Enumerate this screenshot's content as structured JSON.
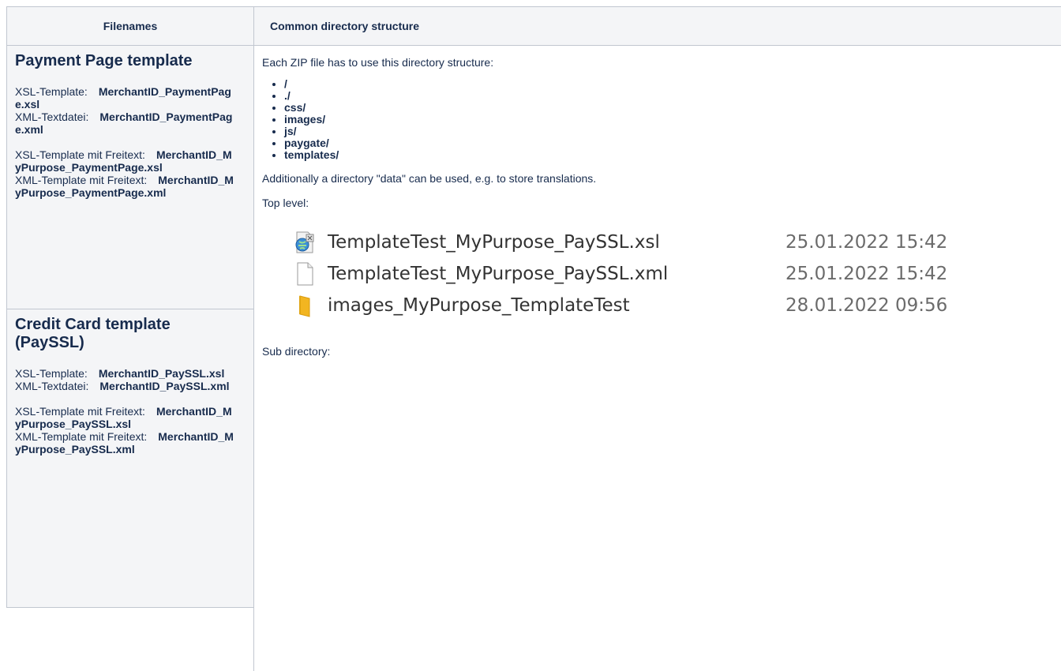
{
  "header": {
    "col1": "Filenames",
    "col2": "Common directory structure"
  },
  "payment": {
    "title": "Payment Page template",
    "rows": [
      {
        "k": "XSL-Template:",
        "v": "MerchantID_PaymentPage.xsl"
      },
      {
        "k": "XML-Textdatei:",
        "v": "MerchantID_PaymentPage.xml"
      },
      {
        "k": "XSL-Template mit Freitext:",
        "v": "MerchantID_MyPurpose_PaymentPage.xsl"
      },
      {
        "k": "XML-Template mit Freitext:",
        "v": "MerchantID_MyPurpose_PaymentPage.xml"
      }
    ]
  },
  "credit": {
    "title": "Credit Card template (PaySSL)",
    "rows": [
      {
        "k": "XSL-Template:",
        "v": "MerchantID_PaySSL.xsl"
      },
      {
        "k": "XML-Textdatei:",
        "v": "MerchantID_PaySSL.xml"
      },
      {
        "k": "XSL-Template mit Freitext:",
        "v": "MerchantID_MyPurpose_PaySSL.xsl"
      },
      {
        "k": "XML-Template mit Freitext:",
        "v": "MerchantID_MyPurpose_PaySSL.xml"
      }
    ]
  },
  "structure": {
    "intro": "Each ZIP file has to use this directory structure:",
    "dirs": [
      "/",
      "./",
      "css/",
      "images/",
      "js/",
      "paygate/",
      "templates/"
    ],
    "additional": "Additionally a directory \"data\" can be used, e.g. to store translations.",
    "top_level": "Top level:",
    "files": [
      {
        "name": "TemplateTest_MyPurpose_PaySSL.xsl",
        "date": "25.01.2022 15:42",
        "icon": "xsl-file-icon"
      },
      {
        "name": "TemplateTest_MyPurpose_PaySSL.xml",
        "date": "25.01.2022 15:42",
        "icon": "blank-file-icon"
      },
      {
        "name": "images_MyPurpose_TemplateTest",
        "date": "28.01.2022 09:56",
        "icon": "folder-icon"
      }
    ],
    "sub_directory": "Sub directory:"
  }
}
